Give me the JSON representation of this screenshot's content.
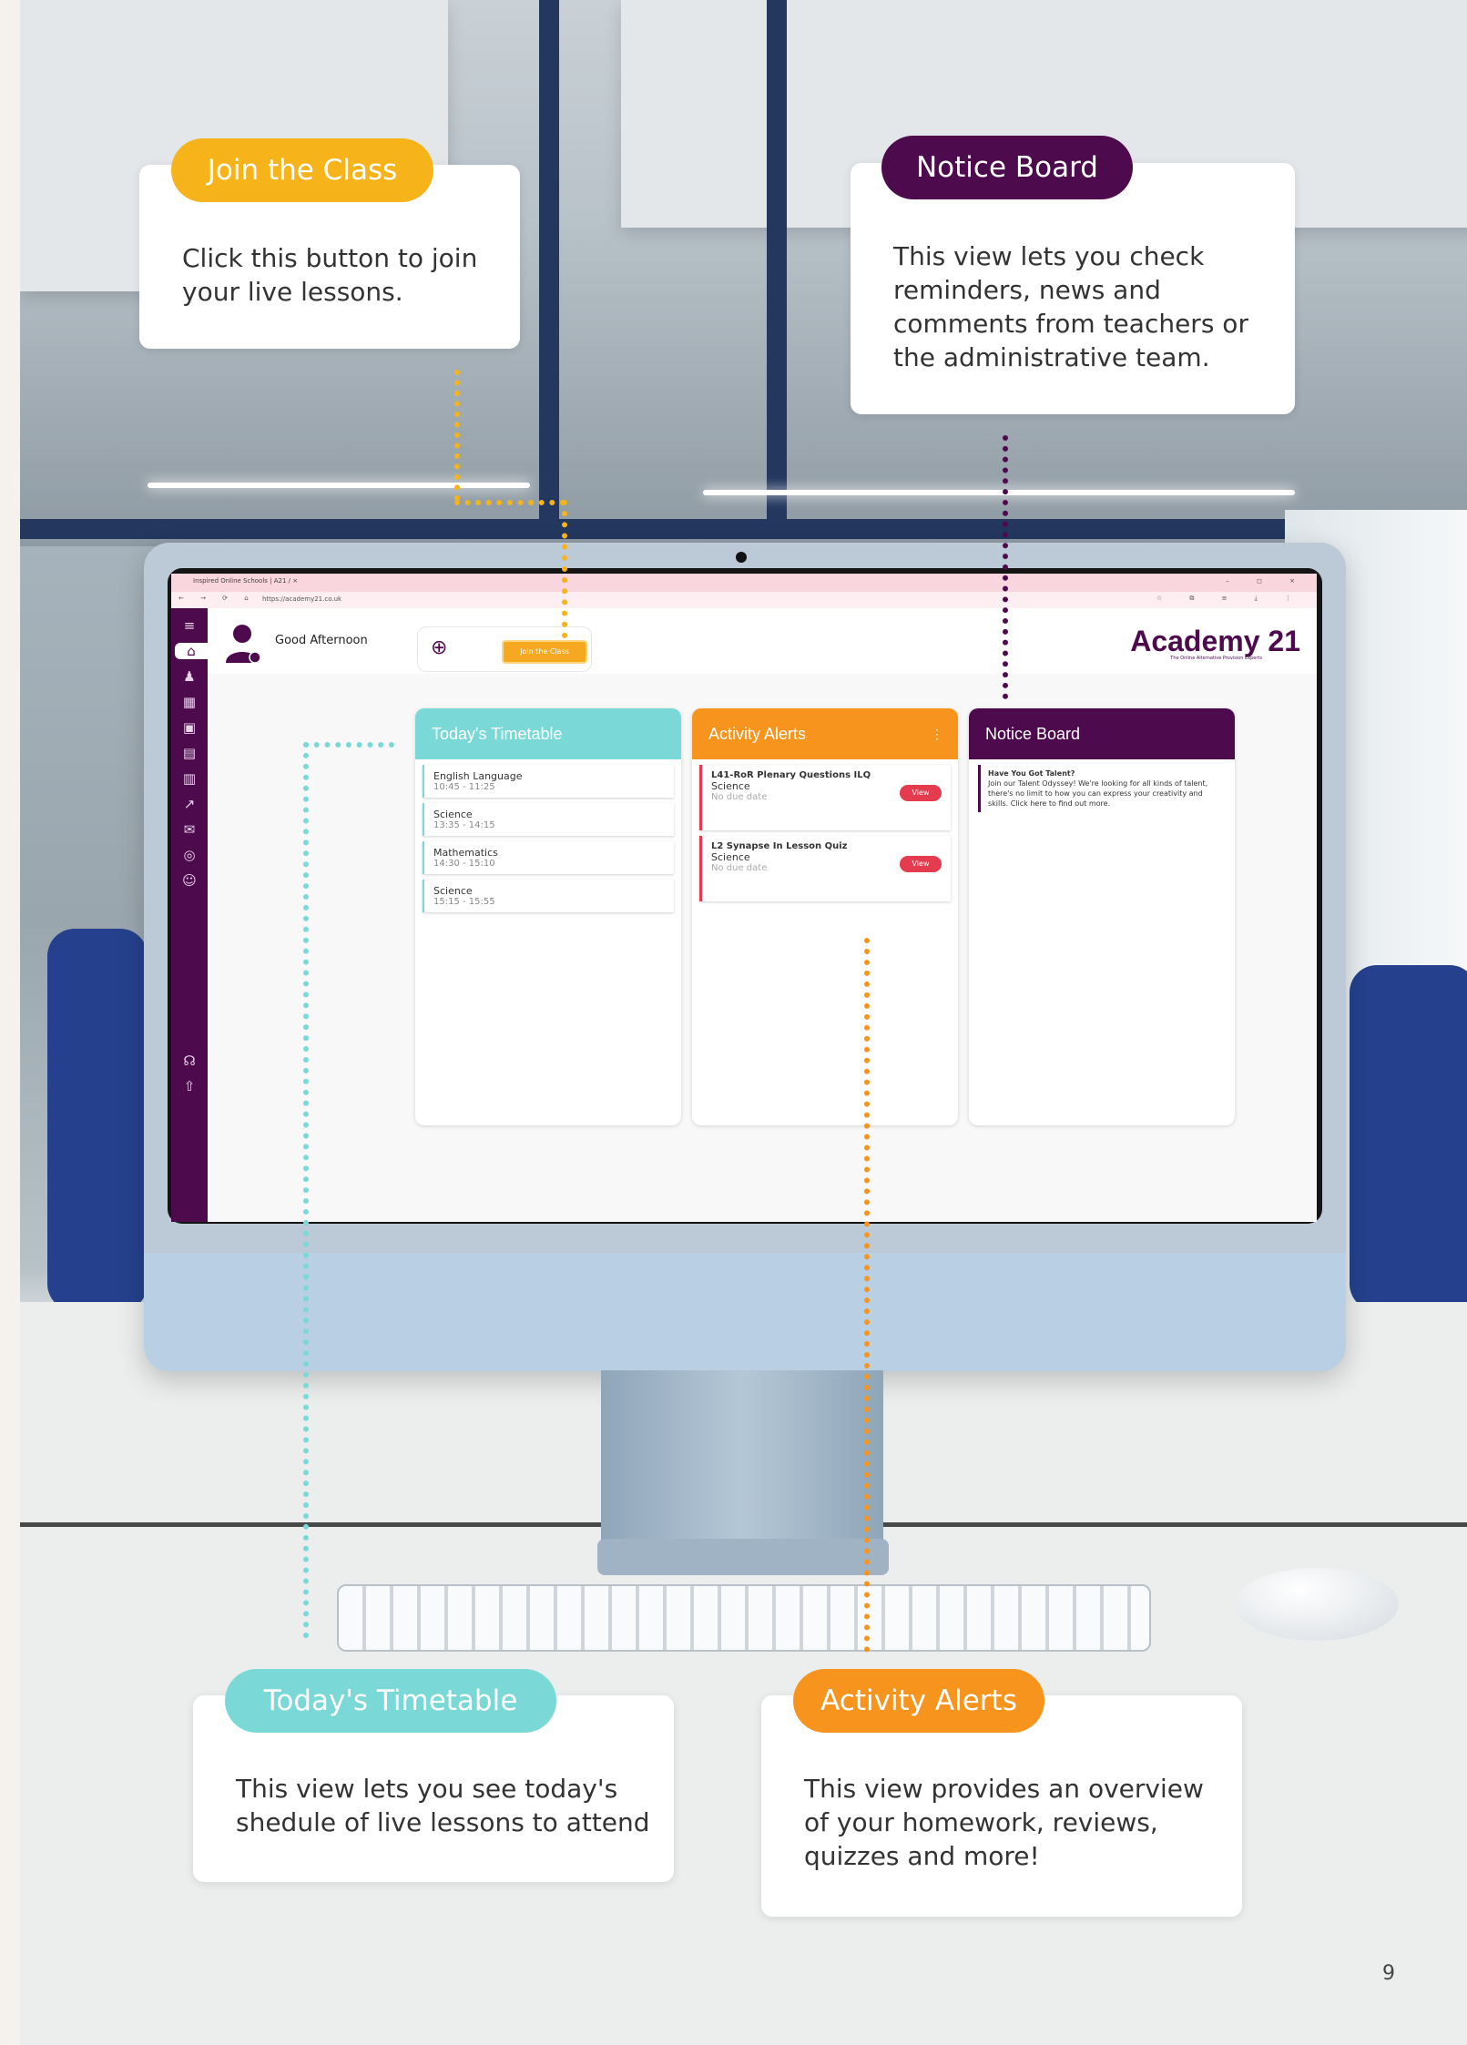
{
  "colors": {
    "join": "#f6b31a",
    "notice": "#4d0b4e",
    "timetable": "#7ad8d7",
    "alerts": "#f6941d",
    "alert_red": "#e43b4f"
  },
  "callouts": {
    "join": {
      "title": "Join the Class",
      "text": "Click this button to join your live lessons."
    },
    "notice": {
      "title": "Notice Board",
      "text": "This view lets you check reminders, news and comments from teachers or the administrative team."
    },
    "timetable": {
      "title": "Today's Timetable",
      "text": "This view lets you see today's shedule of live lessons to attend"
    },
    "alerts": {
      "title": "Activity Alerts",
      "text": "This view provides an overview of your homework, reviews, quizzes and more!"
    }
  },
  "screen": {
    "browser": {
      "tab_title": "Inspired Online Schools | A21 / ×",
      "url": "https://academy21.co.uk",
      "window_controls": "– ◻ ×",
      "nav_icons": "← → ⟳ ⌂",
      "tool_icons": "☆ ⧉ ≡ ⤓ ⋮"
    },
    "greeting": "Good Afternoon",
    "join_button": "Join the Class",
    "logo": "Academy 21",
    "logo_tagline": "The Online Alternative Provision Experts",
    "sidebar_icons": [
      "menu-icon",
      "home-icon",
      "users-icon",
      "grid-icon",
      "briefcase-icon",
      "table-icon",
      "calendar-icon",
      "chart-icon",
      "mail-icon",
      "globe-icon",
      "person-icon",
      "headset-icon",
      "logout-icon"
    ],
    "timetable": {
      "title": "Today's Timetable",
      "items": [
        {
          "subject": "English Language",
          "time": "10:45 - 11:25"
        },
        {
          "subject": "Science",
          "time": "13:35 - 14:15"
        },
        {
          "subject": "Mathematics",
          "time": "14:30 - 15:10"
        },
        {
          "subject": "Science",
          "time": "15:15 - 15:55"
        }
      ]
    },
    "alerts": {
      "title": "Activity Alerts",
      "menu": "⋮",
      "items": [
        {
          "title": "L41-RoR Plenary Questions ILQ",
          "subject": "Science",
          "due": "No due date",
          "button": "View"
        },
        {
          "title": "L2 Synapse In Lesson Quiz",
          "subject": "Science",
          "due": "No due date",
          "button": "View"
        }
      ]
    },
    "notice": {
      "title": "Notice Board",
      "post_title": "Have You Got Talent?",
      "post_body": "Join our Talent Odyssey! We're looking for all kinds of talent, there's no limit to how you can express your creativity and skills. Click here to find out more."
    }
  },
  "page_number": "9"
}
